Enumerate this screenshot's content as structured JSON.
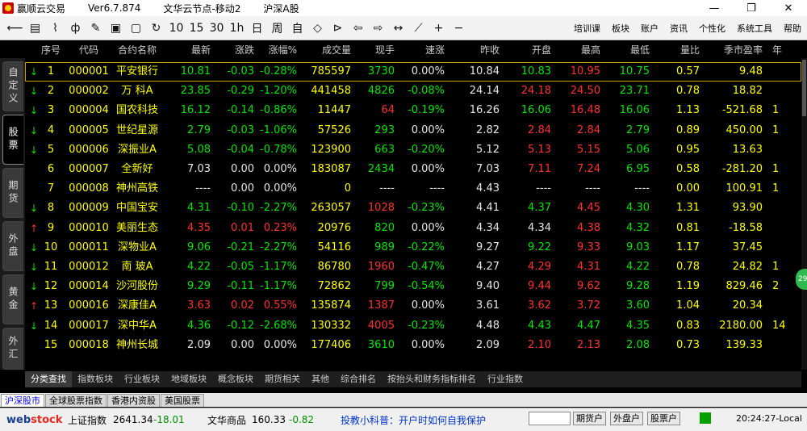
{
  "window": {
    "app_name": "赢顺云交易",
    "version": "Ver6.7.874",
    "node": "文华云节点-移动2",
    "market": "沪深A股",
    "minimize": "—",
    "maximize": "❐",
    "close": "✕"
  },
  "toolbar": {
    "icons": [
      {
        "name": "back-icon",
        "glyph": "⟵"
      },
      {
        "name": "list-icon",
        "glyph": "▤"
      },
      {
        "name": "line-chart-icon",
        "glyph": "⌇"
      },
      {
        "name": "candlestick-icon",
        "glyph": "ф"
      },
      {
        "name": "draw-icon",
        "glyph": "✎"
      },
      {
        "name": "f10-icon",
        "glyph": "▣"
      },
      {
        "name": "save-icon",
        "glyph": "▢"
      },
      {
        "name": "refresh-icon",
        "glyph": "↻"
      },
      {
        "name": "period-10",
        "glyph": "10"
      },
      {
        "name": "period-15",
        "glyph": "15"
      },
      {
        "name": "period-30",
        "glyph": "30"
      },
      {
        "name": "period-1h",
        "glyph": "1h"
      },
      {
        "name": "period-day",
        "glyph": "日"
      },
      {
        "name": "period-week",
        "glyph": "周"
      },
      {
        "name": "period-custom",
        "glyph": "自"
      },
      {
        "name": "zoom-icon",
        "glyph": "◇"
      },
      {
        "name": "shrink-icon",
        "glyph": "⊳"
      },
      {
        "name": "prev-icon",
        "glyph": "⇦"
      },
      {
        "name": "next-icon",
        "glyph": "⇨"
      },
      {
        "name": "crosshair-icon",
        "glyph": "↔"
      },
      {
        "name": "pen-line-icon",
        "glyph": "⟋"
      },
      {
        "name": "add-icon",
        "glyph": "+"
      },
      {
        "name": "minus-icon",
        "glyph": "−"
      }
    ],
    "menu": [
      "培训课",
      "板块",
      "账户",
      "资讯",
      "个性化",
      "系统工具",
      "帮助"
    ]
  },
  "left_tabs": [
    "自定义",
    "股票",
    "期货",
    "外盘",
    "黄金",
    "外汇"
  ],
  "columns": [
    "序号",
    "代码",
    "合约名称",
    "最新",
    "涨跌",
    "涨幅%",
    "成交量",
    "现手",
    "速涨",
    "昨收",
    "开盘",
    "最高",
    "最低",
    "量比",
    "季市盈率",
    "年"
  ],
  "rows": [
    {
      "arrow": "down",
      "seq": "1",
      "code": "000001",
      "name": "平安银行",
      "last": "10.81",
      "chg": "-0.03",
      "pct": "-0.28%",
      "vol": "785597",
      "hand": "3730",
      "speed": "0.00%",
      "prev": "10.84",
      "open": "10.83",
      "high": "10.95",
      "low": "10.75",
      "ratio": "0.57",
      "pe": "9.48",
      "yr": "",
      "c_last": "grn",
      "c_open": "grn",
      "c_high": "red",
      "c_low": "grn",
      "c_hand": "grn",
      "c_speed": "wht"
    },
    {
      "arrow": "down",
      "seq": "2",
      "code": "000002",
      "name": "万 科A",
      "last": "23.85",
      "chg": "-0.29",
      "pct": "-1.20%",
      "vol": "441458",
      "hand": "4826",
      "speed": "-0.08%",
      "prev": "24.14",
      "open": "24.18",
      "high": "24.50",
      "low": "23.71",
      "ratio": "0.78",
      "pe": "18.82",
      "yr": "",
      "c_last": "grn",
      "c_open": "red",
      "c_high": "red",
      "c_low": "grn",
      "c_hand": "grn",
      "c_speed": "grn"
    },
    {
      "arrow": "down",
      "seq": "3",
      "code": "000004",
      "name": "国农科技",
      "last": "16.12",
      "chg": "-0.14",
      "pct": "-0.86%",
      "vol": "11447",
      "hand": "64",
      "speed": "-0.19%",
      "prev": "16.26",
      "open": "16.06",
      "high": "16.48",
      "low": "16.06",
      "ratio": "1.13",
      "pe": "-521.68",
      "yr": "1",
      "c_last": "grn",
      "c_open": "grn",
      "c_high": "red",
      "c_low": "grn",
      "c_hand": "red",
      "c_speed": "grn"
    },
    {
      "arrow": "down",
      "seq": "4",
      "code": "000005",
      "name": "世纪星源",
      "last": "2.79",
      "chg": "-0.03",
      "pct": "-1.06%",
      "vol": "57526",
      "hand": "293",
      "speed": "0.00%",
      "prev": "2.82",
      "open": "2.84",
      "high": "2.84",
      "low": "2.79",
      "ratio": "0.89",
      "pe": "450.00",
      "yr": "1",
      "c_last": "grn",
      "c_open": "red",
      "c_high": "red",
      "c_low": "grn",
      "c_hand": "grn",
      "c_speed": "wht"
    },
    {
      "arrow": "down",
      "seq": "5",
      "code": "000006",
      "name": "深振业A",
      "last": "5.08",
      "chg": "-0.04",
      "pct": "-0.78%",
      "vol": "123900",
      "hand": "663",
      "speed": "-0.20%",
      "prev": "5.12",
      "open": "5.13",
      "high": "5.15",
      "low": "5.06",
      "ratio": "0.95",
      "pe": "13.63",
      "yr": "",
      "c_last": "grn",
      "c_open": "red",
      "c_high": "red",
      "c_low": "grn",
      "c_hand": "grn",
      "c_speed": "grn"
    },
    {
      "arrow": "",
      "seq": "6",
      "code": "000007",
      "name": "全新好",
      "last": "7.03",
      "chg": "0.00",
      "pct": "0.00%",
      "vol": "183087",
      "hand": "2434",
      "speed": "0.00%",
      "prev": "7.03",
      "open": "7.11",
      "high": "7.24",
      "low": "6.95",
      "ratio": "0.58",
      "pe": "-281.20",
      "yr": "1",
      "c_last": "wht",
      "c_open": "red",
      "c_high": "red",
      "c_low": "grn",
      "c_hand": "grn",
      "c_speed": "wht"
    },
    {
      "arrow": "",
      "seq": "7",
      "code": "000008",
      "name": "神州高铁",
      "last": "----",
      "chg": "0.00",
      "pct": "0.00%",
      "vol": "0",
      "hand": "----",
      "speed": "----",
      "prev": "4.43",
      "open": "----",
      "high": "----",
      "low": "----",
      "ratio": "0.00",
      "pe": "100.91",
      "yr": "1",
      "c_last": "wht",
      "c_open": "wht",
      "c_high": "wht",
      "c_low": "wht",
      "c_hand": "wht",
      "c_speed": "wht"
    },
    {
      "arrow": "down",
      "seq": "8",
      "code": "000009",
      "name": "中国宝安",
      "last": "4.31",
      "chg": "-0.10",
      "pct": "-2.27%",
      "vol": "263057",
      "hand": "1028",
      "speed": "-0.23%",
      "prev": "4.41",
      "open": "4.37",
      "high": "4.45",
      "low": "4.30",
      "ratio": "1.31",
      "pe": "93.90",
      "yr": "",
      "c_last": "grn",
      "c_open": "grn",
      "c_high": "red",
      "c_low": "grn",
      "c_hand": "red",
      "c_speed": "grn"
    },
    {
      "arrow": "up",
      "seq": "9",
      "code": "000010",
      "name": "美丽生态",
      "last": "4.35",
      "chg": "0.01",
      "pct": "0.23%",
      "vol": "20976",
      "hand": "820",
      "speed": "0.00%",
      "prev": "4.34",
      "open": "4.34",
      "high": "4.38",
      "low": "4.32",
      "ratio": "0.81",
      "pe": "-18.58",
      "yr": "",
      "c_last": "red",
      "c_open": "wht",
      "c_high": "red",
      "c_low": "grn",
      "c_hand": "grn",
      "c_speed": "wht"
    },
    {
      "arrow": "down",
      "seq": "10",
      "code": "000011",
      "name": "深物业A",
      "last": "9.06",
      "chg": "-0.21",
      "pct": "-2.27%",
      "vol": "54116",
      "hand": "989",
      "speed": "-0.22%",
      "prev": "9.27",
      "open": "9.22",
      "high": "9.33",
      "low": "9.03",
      "ratio": "1.17",
      "pe": "37.45",
      "yr": "",
      "c_last": "grn",
      "c_open": "grn",
      "c_high": "red",
      "c_low": "grn",
      "c_hand": "grn",
      "c_speed": "grn"
    },
    {
      "arrow": "down",
      "seq": "11",
      "code": "000012",
      "name": "南 玻A",
      "last": "4.22",
      "chg": "-0.05",
      "pct": "-1.17%",
      "vol": "86780",
      "hand": "1960",
      "speed": "-0.47%",
      "prev": "4.27",
      "open": "4.29",
      "high": "4.31",
      "low": "4.22",
      "ratio": "0.78",
      "pe": "24.82",
      "yr": "1",
      "c_last": "grn",
      "c_open": "red",
      "c_high": "red",
      "c_low": "grn",
      "c_hand": "red",
      "c_speed": "grn"
    },
    {
      "arrow": "down",
      "seq": "12",
      "code": "000014",
      "name": "沙河股份",
      "last": "9.29",
      "chg": "-0.11",
      "pct": "-1.17%",
      "vol": "72862",
      "hand": "799",
      "speed": "-0.54%",
      "prev": "9.40",
      "open": "9.44",
      "high": "9.62",
      "low": "9.28",
      "ratio": "1.19",
      "pe": "829.46",
      "yr": "2",
      "c_last": "grn",
      "c_open": "red",
      "c_high": "red",
      "c_low": "grn",
      "c_hand": "grn",
      "c_speed": "grn"
    },
    {
      "arrow": "up",
      "seq": "13",
      "code": "000016",
      "name": "深康佳A",
      "last": "3.63",
      "chg": "0.02",
      "pct": "0.55%",
      "vol": "135874",
      "hand": "1387",
      "speed": "0.00%",
      "prev": "3.61",
      "open": "3.62",
      "high": "3.72",
      "low": "3.60",
      "ratio": "1.04",
      "pe": "20.34",
      "yr": "",
      "c_last": "red",
      "c_open": "red",
      "c_high": "red",
      "c_low": "grn",
      "c_hand": "red",
      "c_speed": "wht"
    },
    {
      "arrow": "down",
      "seq": "14",
      "code": "000017",
      "name": "深中华A",
      "last": "4.36",
      "chg": "-0.12",
      "pct": "-2.68%",
      "vol": "130332",
      "hand": "4005",
      "speed": "-0.23%",
      "prev": "4.48",
      "open": "4.43",
      "high": "4.47",
      "low": "4.35",
      "ratio": "0.83",
      "pe": "2180.00",
      "yr": "14",
      "c_last": "grn",
      "c_open": "grn",
      "c_high": "grn",
      "c_low": "grn",
      "c_hand": "red",
      "c_speed": "grn"
    },
    {
      "arrow": "",
      "seq": "15",
      "code": "000018",
      "name": "神州长城",
      "last": "2.09",
      "chg": "0.00",
      "pct": "0.00%",
      "vol": "177406",
      "hand": "3610",
      "speed": "0.00%",
      "prev": "2.09",
      "open": "2.10",
      "high": "2.13",
      "low": "2.08",
      "ratio": "0.73",
      "pe": "139.33",
      "yr": "",
      "c_last": "wht",
      "c_open": "red",
      "c_high": "red",
      "c_low": "grn",
      "c_hand": "grn",
      "c_speed": "wht"
    }
  ],
  "category_tabs": [
    "分类查找",
    "指数板块",
    "行业板块",
    "地域板块",
    "概念板块",
    "期货相关",
    "其他",
    "综合排名",
    "按抬头和财务指标排名",
    "行业指数"
  ],
  "market_tabs": [
    "沪深股市",
    "全球股票指数",
    "香港内资股",
    "美国股票"
  ],
  "status": {
    "logo_a": "web",
    "logo_b": "stock",
    "sh_label": "上证指数",
    "sh_value": "2641.34",
    "sh_chg": "-18.01",
    "wh_label": "文华商品",
    "wh_value": "160.33",
    "wh_chg": "-0.82",
    "tip": "投教小科普：开户时如何自我保护",
    "btn_futures": "期货户",
    "btn_foreign": "外盘户",
    "btn_stock": "股票户",
    "time": "20:24:27-Local"
  },
  "side_badge": "29"
}
